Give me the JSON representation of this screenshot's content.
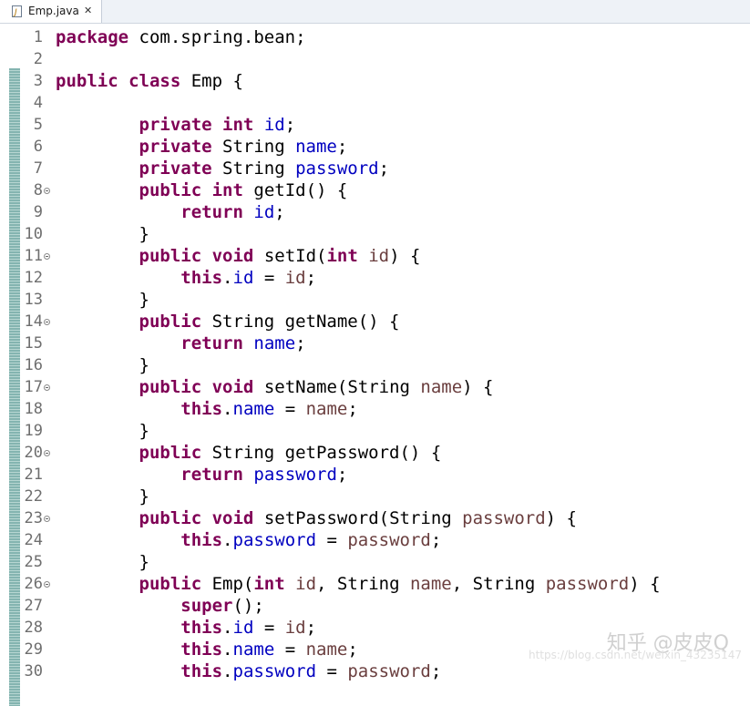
{
  "tab": {
    "label": "Emp.java",
    "icon": "java-file-icon",
    "close_icon": "close-icon"
  },
  "colors": {
    "keyword": "#7f0055",
    "field": "#0000c0",
    "parameter": "#6a3e3e",
    "line_number": "#6e6e6e"
  },
  "code_lines": [
    {
      "n": "1",
      "fold": false,
      "tokens": [
        [
          "kw",
          "package"
        ],
        [
          "t",
          " com.spring.bean;"
        ]
      ]
    },
    {
      "n": "2",
      "fold": false,
      "tokens": []
    },
    {
      "n": "3",
      "fold": false,
      "tokens": [
        [
          "kw",
          "public"
        ],
        [
          "t",
          " "
        ],
        [
          "kw",
          "class"
        ],
        [
          "t",
          " Emp {"
        ]
      ]
    },
    {
      "n": "4",
      "fold": false,
      "tokens": []
    },
    {
      "n": "5",
      "fold": false,
      "tokens": [
        [
          "t",
          "        "
        ],
        [
          "kw",
          "private"
        ],
        [
          "t",
          " "
        ],
        [
          "kw",
          "int"
        ],
        [
          "t",
          " "
        ],
        [
          "fld",
          "id"
        ],
        [
          "t",
          ";"
        ]
      ]
    },
    {
      "n": "6",
      "fold": false,
      "tokens": [
        [
          "t",
          "        "
        ],
        [
          "kw",
          "private"
        ],
        [
          "t",
          " String "
        ],
        [
          "fld",
          "name"
        ],
        [
          "t",
          ";"
        ]
      ]
    },
    {
      "n": "7",
      "fold": false,
      "tokens": [
        [
          "t",
          "        "
        ],
        [
          "kw",
          "private"
        ],
        [
          "t",
          " String "
        ],
        [
          "fld",
          "password"
        ],
        [
          "t",
          ";"
        ]
      ]
    },
    {
      "n": "8",
      "fold": true,
      "tokens": [
        [
          "t",
          "        "
        ],
        [
          "kw",
          "public"
        ],
        [
          "t",
          " "
        ],
        [
          "kw",
          "int"
        ],
        [
          "t",
          " getId() {"
        ]
      ]
    },
    {
      "n": "9",
      "fold": false,
      "tokens": [
        [
          "t",
          "            "
        ],
        [
          "kw",
          "return"
        ],
        [
          "t",
          " "
        ],
        [
          "fld",
          "id"
        ],
        [
          "t",
          ";"
        ]
      ]
    },
    {
      "n": "10",
      "fold": false,
      "tokens": [
        [
          "t",
          "        }"
        ]
      ]
    },
    {
      "n": "11",
      "fold": true,
      "tokens": [
        [
          "t",
          "        "
        ],
        [
          "kw",
          "public"
        ],
        [
          "t",
          " "
        ],
        [
          "kw",
          "void"
        ],
        [
          "t",
          " setId("
        ],
        [
          "kw",
          "int"
        ],
        [
          "t",
          " "
        ],
        [
          "par",
          "id"
        ],
        [
          "t",
          ") {"
        ]
      ]
    },
    {
      "n": "12",
      "fold": false,
      "tokens": [
        [
          "t",
          "            "
        ],
        [
          "kw",
          "this"
        ],
        [
          "t",
          "."
        ],
        [
          "fld",
          "id"
        ],
        [
          "t",
          " = "
        ],
        [
          "par",
          "id"
        ],
        [
          "t",
          ";"
        ]
      ]
    },
    {
      "n": "13",
      "fold": false,
      "tokens": [
        [
          "t",
          "        }"
        ]
      ]
    },
    {
      "n": "14",
      "fold": true,
      "tokens": [
        [
          "t",
          "        "
        ],
        [
          "kw",
          "public"
        ],
        [
          "t",
          " String getName() {"
        ]
      ]
    },
    {
      "n": "15",
      "fold": false,
      "tokens": [
        [
          "t",
          "            "
        ],
        [
          "kw",
          "return"
        ],
        [
          "t",
          " "
        ],
        [
          "fld",
          "name"
        ],
        [
          "t",
          ";"
        ]
      ]
    },
    {
      "n": "16",
      "fold": false,
      "tokens": [
        [
          "t",
          "        }"
        ]
      ]
    },
    {
      "n": "17",
      "fold": true,
      "tokens": [
        [
          "t",
          "        "
        ],
        [
          "kw",
          "public"
        ],
        [
          "t",
          " "
        ],
        [
          "kw",
          "void"
        ],
        [
          "t",
          " setName(String "
        ],
        [
          "par",
          "name"
        ],
        [
          "t",
          ") {"
        ]
      ]
    },
    {
      "n": "18",
      "fold": false,
      "tokens": [
        [
          "t",
          "            "
        ],
        [
          "kw",
          "this"
        ],
        [
          "t",
          "."
        ],
        [
          "fld",
          "name"
        ],
        [
          "t",
          " = "
        ],
        [
          "par",
          "name"
        ],
        [
          "t",
          ";"
        ]
      ]
    },
    {
      "n": "19",
      "fold": false,
      "tokens": [
        [
          "t",
          "        }"
        ]
      ]
    },
    {
      "n": "20",
      "fold": true,
      "tokens": [
        [
          "t",
          "        "
        ],
        [
          "kw",
          "public"
        ],
        [
          "t",
          " String getPassword() {"
        ]
      ]
    },
    {
      "n": "21",
      "fold": false,
      "tokens": [
        [
          "t",
          "            "
        ],
        [
          "kw",
          "return"
        ],
        [
          "t",
          " "
        ],
        [
          "fld",
          "password"
        ],
        [
          "t",
          ";"
        ]
      ]
    },
    {
      "n": "22",
      "fold": false,
      "tokens": [
        [
          "t",
          "        }"
        ]
      ]
    },
    {
      "n": "23",
      "fold": true,
      "tokens": [
        [
          "t",
          "        "
        ],
        [
          "kw",
          "public"
        ],
        [
          "t",
          " "
        ],
        [
          "kw",
          "void"
        ],
        [
          "t",
          " setPassword(String "
        ],
        [
          "par",
          "password"
        ],
        [
          "t",
          ") {"
        ]
      ]
    },
    {
      "n": "24",
      "fold": false,
      "tokens": [
        [
          "t",
          "            "
        ],
        [
          "kw",
          "this"
        ],
        [
          "t",
          "."
        ],
        [
          "fld",
          "password"
        ],
        [
          "t",
          " = "
        ],
        [
          "par",
          "password"
        ],
        [
          "t",
          ";"
        ]
      ]
    },
    {
      "n": "25",
      "fold": false,
      "tokens": [
        [
          "t",
          "        }"
        ]
      ]
    },
    {
      "n": "26",
      "fold": true,
      "tokens": [
        [
          "t",
          "        "
        ],
        [
          "kw",
          "public"
        ],
        [
          "t",
          " Emp("
        ],
        [
          "kw",
          "int"
        ],
        [
          "t",
          " "
        ],
        [
          "par",
          "id"
        ],
        [
          "t",
          ", String "
        ],
        [
          "par",
          "name"
        ],
        [
          "t",
          ", String "
        ],
        [
          "par",
          "password"
        ],
        [
          "t",
          ") {"
        ]
      ]
    },
    {
      "n": "27",
      "fold": false,
      "tokens": [
        [
          "t",
          "            "
        ],
        [
          "kw",
          "super"
        ],
        [
          "t",
          "();"
        ]
      ]
    },
    {
      "n": "28",
      "fold": false,
      "tokens": [
        [
          "t",
          "            "
        ],
        [
          "kw",
          "this"
        ],
        [
          "t",
          "."
        ],
        [
          "fld",
          "id"
        ],
        [
          "t",
          " = "
        ],
        [
          "par",
          "id"
        ],
        [
          "t",
          ";"
        ]
      ]
    },
    {
      "n": "29",
      "fold": false,
      "tokens": [
        [
          "t",
          "            "
        ],
        [
          "kw",
          "this"
        ],
        [
          "t",
          "."
        ],
        [
          "fld",
          "name"
        ],
        [
          "t",
          " = "
        ],
        [
          "par",
          "name"
        ],
        [
          "t",
          ";"
        ]
      ]
    },
    {
      "n": "30",
      "fold": false,
      "tokens": [
        [
          "t",
          "            "
        ],
        [
          "kw",
          "this"
        ],
        [
          "t",
          "."
        ],
        [
          "fld",
          "password"
        ],
        [
          "t",
          " = "
        ],
        [
          "par",
          "password"
        ],
        [
          "t",
          ";"
        ]
      ]
    }
  ],
  "watermark": {
    "main": "知乎 @皮皮Q",
    "sub": "https://blog.csdn.net/weixin_43235147"
  }
}
